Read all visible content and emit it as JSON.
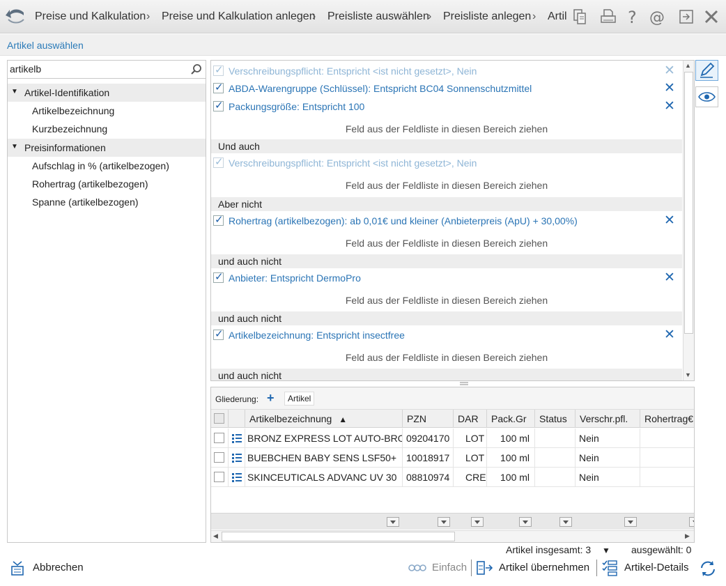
{
  "breadcrumb": {
    "items": [
      "Preise und Kalkulation",
      "Preise und Kalkulation anlegen",
      "Preisliste auswählen",
      "Preisliste anlegen",
      "Artil"
    ],
    "separator": "›"
  },
  "dialog": {
    "title": "Artikel auswählen"
  },
  "search": {
    "value": "artikelb"
  },
  "fieldlist": {
    "groups": [
      {
        "label": "Artikel-Identifikation",
        "items": [
          "Artikelbezeichnung",
          "Kurzbezeichnung"
        ]
      },
      {
        "label": "Preisinformationen",
        "items": [
          "Aufschlag in % (artikelbezogen)",
          "Rohertrag (artikelbezogen)",
          "Spanne (artikelbezogen)"
        ]
      }
    ]
  },
  "filters": {
    "drop_hint": "Feld aus der Feldliste in diesen Bereich ziehen",
    "block1": [
      "Verschreibungspflicht: Entspricht <ist nicht gesetzt>, Nein",
      "ABDA-Warengruppe (Schlüssel): Entspricht BC04 Sonnenschutzmittel",
      "Packungsgröße: Entspricht 100"
    ],
    "sections": [
      {
        "label": "Und auch",
        "item": "Verschreibungspflicht: Entspricht <ist nicht gesetzt>, Nein"
      },
      {
        "label": "Aber nicht",
        "item": "Rohertrag (artikelbezogen): ab 0,01€ und kleiner (Anbieterpreis (ApU) + 30,00%)"
      },
      {
        "label": "und auch nicht",
        "item": "Anbieter: Entspricht  DermoPro"
      },
      {
        "label": "und auch nicht",
        "item": "Artikelbezeichnung: Entspricht insectfree"
      },
      {
        "label": "und auch nicht"
      }
    ]
  },
  "grid": {
    "grouping_label": "Gliederung:",
    "grouping_chip": "Artikel",
    "columns": [
      "Artikelbezeichnung",
      "PZN",
      "DAR",
      "Pack.Gr",
      "Status",
      "Verschr.pfl.",
      "Rohertrag€"
    ],
    "sort_indicator": "▲",
    "rows": [
      {
        "name": "BRONZ EXPRESS LOT AUTO-BRO",
        "pzn": "09204170",
        "dar": "LOT",
        "pack": "100 ml",
        "status": "",
        "verschr": "Nein"
      },
      {
        "name": "BUEBCHEN BABY SENS LSF50+",
        "pzn": "10018917",
        "dar": "LOT",
        "pack": "100 ml",
        "status": "",
        "verschr": "Nein"
      },
      {
        "name": "SKINCEUTICALS ADVANC UV 30",
        "pzn": "08810974",
        "dar": "CRE",
        "pack": "100 ml",
        "status": "",
        "verschr": "Nein"
      }
    ]
  },
  "status": {
    "total": "Artikel insgesamt: 3",
    "total_dropdown": "▼",
    "selected": "ausgewählt: 0"
  },
  "footer": {
    "cancel": "Abbrechen",
    "simple": "Einfach",
    "take_over": "Artikel übernehmen",
    "details": "Artikel-Details"
  },
  "colors": {
    "accent": "#2a74b5",
    "accent_dim": "#8eb5d6",
    "x_icon": "#1f67b0"
  }
}
